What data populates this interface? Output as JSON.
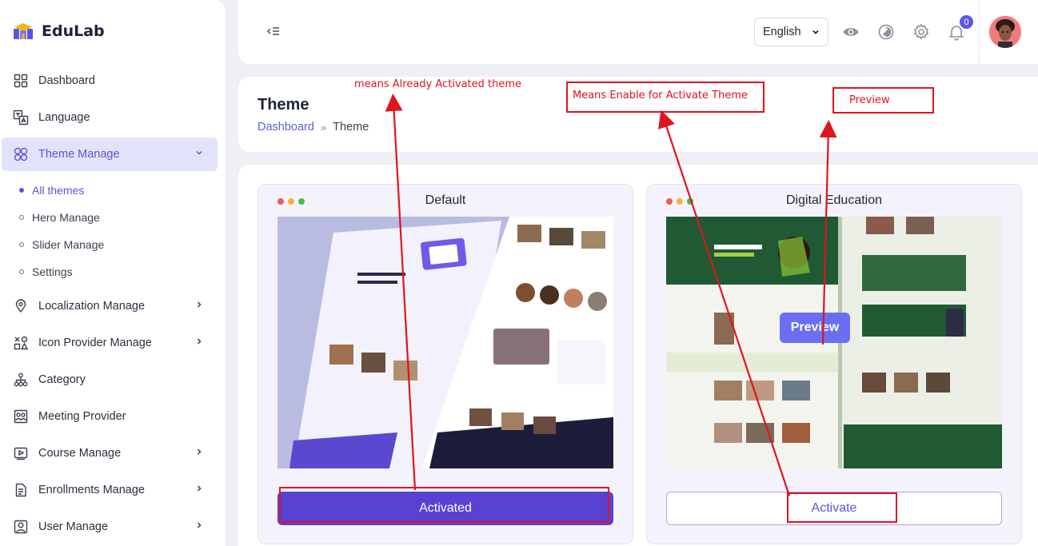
{
  "brand": {
    "name": "EduLab"
  },
  "sidebar": {
    "items": [
      {
        "label": "Dashboard",
        "icon": "grid-icon"
      },
      {
        "label": "Language",
        "icon": "translate-icon"
      },
      {
        "label": "Theme Manage",
        "icon": "theme-icon",
        "expanded": true
      },
      {
        "label": "Localization Manage",
        "icon": "location-icon"
      },
      {
        "label": "Icon Provider Manage",
        "icon": "shapes-icon"
      },
      {
        "label": "Category",
        "icon": "hierarchy-icon"
      },
      {
        "label": "Meeting Provider",
        "icon": "meeting-icon"
      },
      {
        "label": "Course Manage",
        "icon": "video-icon"
      },
      {
        "label": "Enrollments Manage",
        "icon": "document-icon"
      },
      {
        "label": "User Manage",
        "icon": "user-icon"
      }
    ],
    "theme_sub_items": [
      {
        "label": "All themes",
        "active": true
      },
      {
        "label": "Hero Manage"
      },
      {
        "label": "Slider Manage"
      },
      {
        "label": "Settings"
      }
    ]
  },
  "topbar": {
    "language": "English",
    "notification_count": "0"
  },
  "header": {
    "title": "Theme",
    "breadcrumb_home": "Dashboard",
    "breadcrumb_sep": "»",
    "breadcrumb_current": "Theme"
  },
  "themes": [
    {
      "name": "Default",
      "button_label": "Activated",
      "status": "activated"
    },
    {
      "name": "Digital Education",
      "button_label": "Activate",
      "preview_label": "Preview",
      "status": "available"
    }
  ],
  "annotations": {
    "activated_note": "means Already Activated theme",
    "activate_note": "Means Enable for Activate Theme",
    "preview_note": "Preview"
  },
  "colors": {
    "accent": "#5a55d6",
    "activated_button": "#5842d2",
    "preview_button": "#6a6ff2",
    "annotation_red": "#e0141c"
  }
}
